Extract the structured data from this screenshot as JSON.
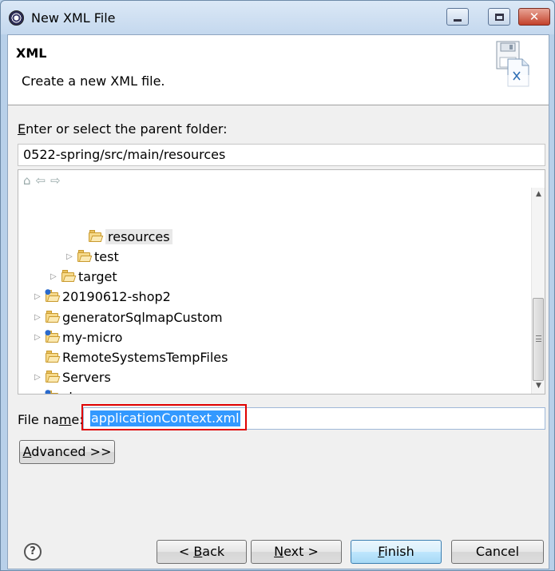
{
  "window": {
    "title": "New XML File"
  },
  "header": {
    "title": "XML",
    "description": "Create a new XML file."
  },
  "folder": {
    "label_accel": "E",
    "label_rest": "nter or select the parent folder:",
    "path": "0522-spring/src/main/resources"
  },
  "tree": {
    "items": [
      {
        "label": "resources",
        "kind": "folder",
        "selected": true,
        "expander": ""
      },
      {
        "label": "test",
        "kind": "folder",
        "expander": "collapsed"
      },
      {
        "label": "target",
        "kind": "folder",
        "expander": "collapsed"
      },
      {
        "label": "20190612-shop2",
        "kind": "project",
        "expander": "collapsed"
      },
      {
        "label": "generatorSqlmapCustom",
        "kind": "project",
        "expander": "collapsed"
      },
      {
        "label": "my-micro",
        "kind": "project",
        "expander": "collapsed"
      },
      {
        "label": "RemoteSystemsTempFiles",
        "kind": "project",
        "expander": ""
      },
      {
        "label": "Servers",
        "kind": "folder",
        "expander": "collapsed"
      },
      {
        "label": "shop",
        "kind": "project",
        "expander": "collapsed"
      }
    ]
  },
  "filename": {
    "label_a": "File na",
    "label_accel": "m",
    "label_b": "e:",
    "value": "applicationContext.xml"
  },
  "buttons": {
    "advanced_accel": "A",
    "advanced_rest": "dvanced >>",
    "back_pre": "< ",
    "back_accel": "B",
    "back_rest": "ack",
    "next_accel": "N",
    "next_rest": "ext >",
    "finish_accel": "F",
    "finish_rest": "inish",
    "cancel": "Cancel",
    "help": "?"
  }
}
